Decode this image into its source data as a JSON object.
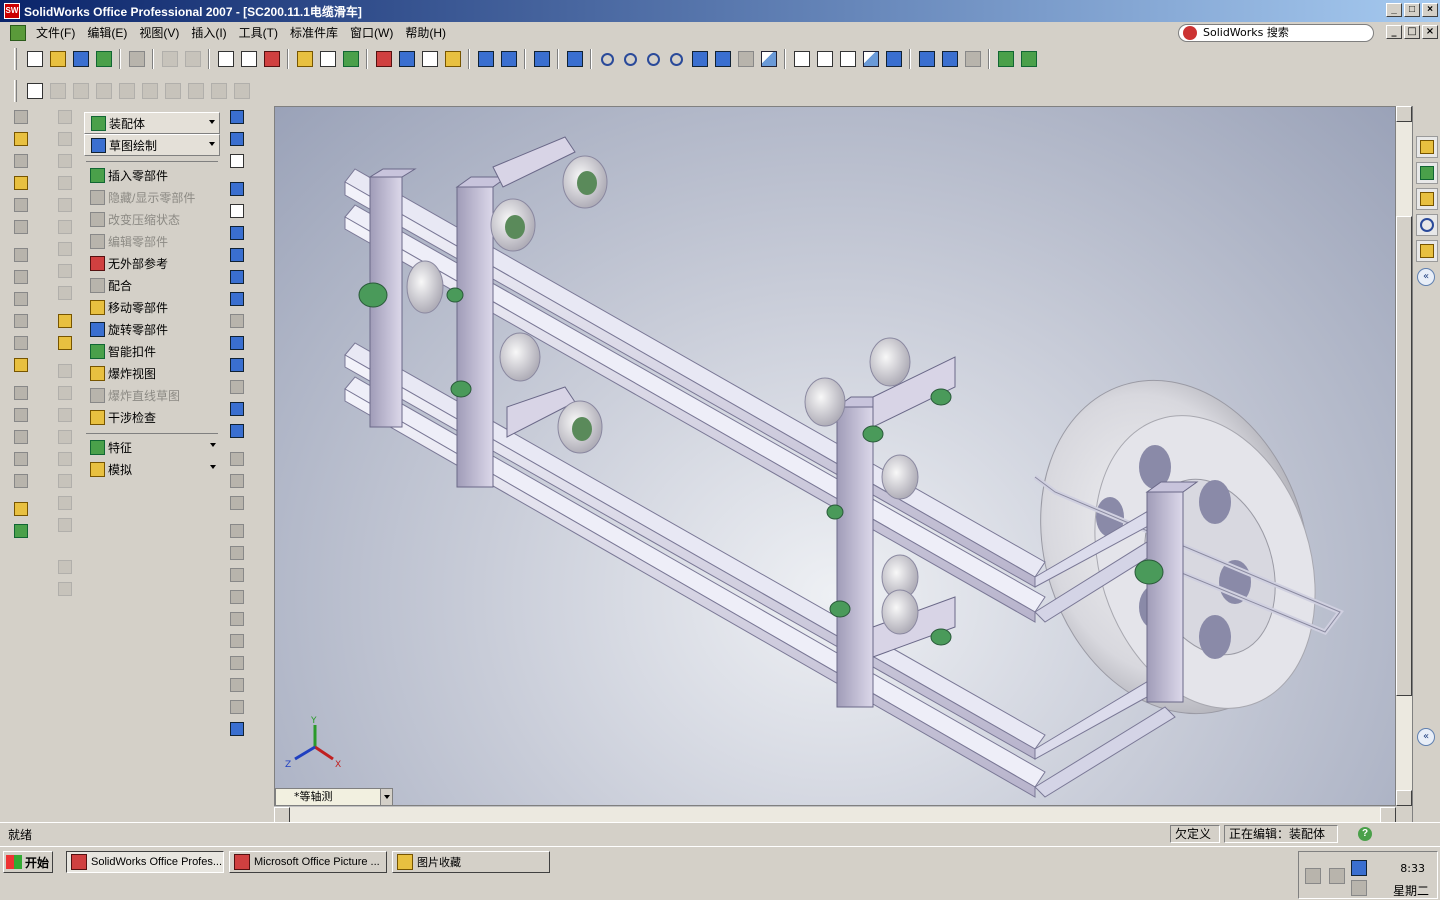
{
  "window": {
    "title": "SolidWorks Office Professional 2007 - [SC200.11.1电缆滑车]"
  },
  "menu": {
    "items": [
      "文件(F)",
      "编辑(E)",
      "视图(V)",
      "插入(I)",
      "工具(T)",
      "标准件库",
      "窗口(W)",
      "帮助(H)"
    ]
  },
  "search": {
    "label": "SolidWorks 搜索"
  },
  "command_manager": {
    "assembly_combo": "装配体",
    "sketch_combo": "草图绘制",
    "items": [
      {
        "label": "插入零部件",
        "enabled": true,
        "icon": "insert-component-icon"
      },
      {
        "label": "隐藏/显示零部件",
        "enabled": false,
        "icon": "hide-show-icon"
      },
      {
        "label": "改变压缩状态",
        "enabled": false,
        "icon": "suppress-icon"
      },
      {
        "label": "编辑零部件",
        "enabled": false,
        "icon": "edit-component-icon"
      },
      {
        "label": "无外部参考",
        "enabled": true,
        "icon": "no-external-ref-icon"
      },
      {
        "label": "配合",
        "enabled": true,
        "icon": "mate-icon"
      },
      {
        "label": "移动零部件",
        "enabled": true,
        "icon": "move-component-icon"
      },
      {
        "label": "旋转零部件",
        "enabled": true,
        "icon": "rotate-component-icon"
      },
      {
        "label": "智能扣件",
        "enabled": true,
        "icon": "smart-fastener-icon"
      },
      {
        "label": "爆炸视图",
        "enabled": true,
        "icon": "exploded-view-icon"
      },
      {
        "label": "爆炸直线草图",
        "enabled": false,
        "icon": "explode-line-icon"
      },
      {
        "label": "干涉检查",
        "enabled": true,
        "icon": "interference-icon"
      }
    ],
    "features_combo": "特征",
    "simulation_combo": "模拟"
  },
  "viewport": {
    "view_orientation": "*等轴测",
    "triad": {
      "x": "X",
      "y": "Y",
      "z": "Z"
    }
  },
  "status": {
    "left": "就绪",
    "defined": "欠定义",
    "editing": "正在编辑：装配体",
    "help": "?"
  },
  "taskbar": {
    "start": "开始",
    "tasks": [
      {
        "label": "SolidWorks Office Profes...",
        "active": true
      },
      {
        "label": "Microsoft Office Picture ...",
        "active": false
      },
      {
        "label": "图片收藏",
        "active": false
      }
    ],
    "clock_time": "8:33",
    "clock_day": "星期二"
  }
}
